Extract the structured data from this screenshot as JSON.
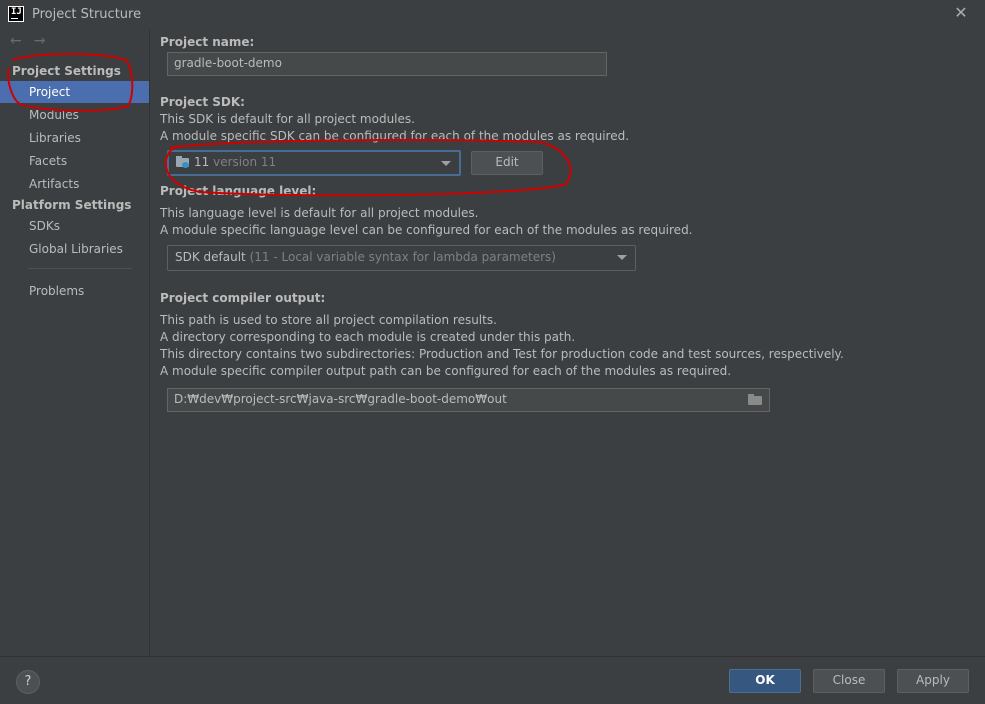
{
  "window": {
    "title": "Project Structure",
    "logo_text": "IJ",
    "close_symbol": "✕"
  },
  "sidebar": {
    "nav_back": "←",
    "nav_forward": "→",
    "sections": [
      {
        "title": "Project Settings",
        "items": [
          "Project",
          "Modules",
          "Libraries",
          "Facets",
          "Artifacts"
        ]
      },
      {
        "title": "Platform Settings",
        "items": [
          "SDKs",
          "Global Libraries"
        ]
      }
    ],
    "extra_items": [
      "Problems"
    ],
    "selected": "Project"
  },
  "project": {
    "name_label": "Project name:",
    "name_value": "gradle-boot-demo",
    "sdk_label": "Project SDK:",
    "sdk_desc_1": "This SDK is default for all project modules.",
    "sdk_desc_2": "A module specific SDK can be configured for each of the modules as required.",
    "sdk_value_main": "11",
    "sdk_value_detail": "version 11",
    "sdk_edit_label": "Edit",
    "lang_label": "Project language level:",
    "lang_desc_1": "This language level is default for all project modules.",
    "lang_desc_2": "A module specific language level can be configured for each of the modules as required.",
    "lang_value_main": "SDK default",
    "lang_value_detail": "(11 - Local variable syntax for lambda parameters)",
    "output_label": "Project compiler output:",
    "output_desc_1": "This path is used to store all project compilation results.",
    "output_desc_2": "A directory corresponding to each module is created under this path.",
    "output_desc_3": "This directory contains two subdirectories: Production and Test for production code and test sources, respectively.",
    "output_desc_4": "A module specific compiler output path can be configured for each of the modules as required.",
    "output_value": "D:₩dev₩project-src₩java-src₩gradle-boot-demo₩out"
  },
  "footer": {
    "help_symbol": "?",
    "ok": "OK",
    "close": "Close",
    "apply": "Apply"
  },
  "colors": {
    "background": "#3c3f41",
    "selection": "#4b6eaf",
    "primary_button": "#365880",
    "annotation": "#d00000"
  }
}
